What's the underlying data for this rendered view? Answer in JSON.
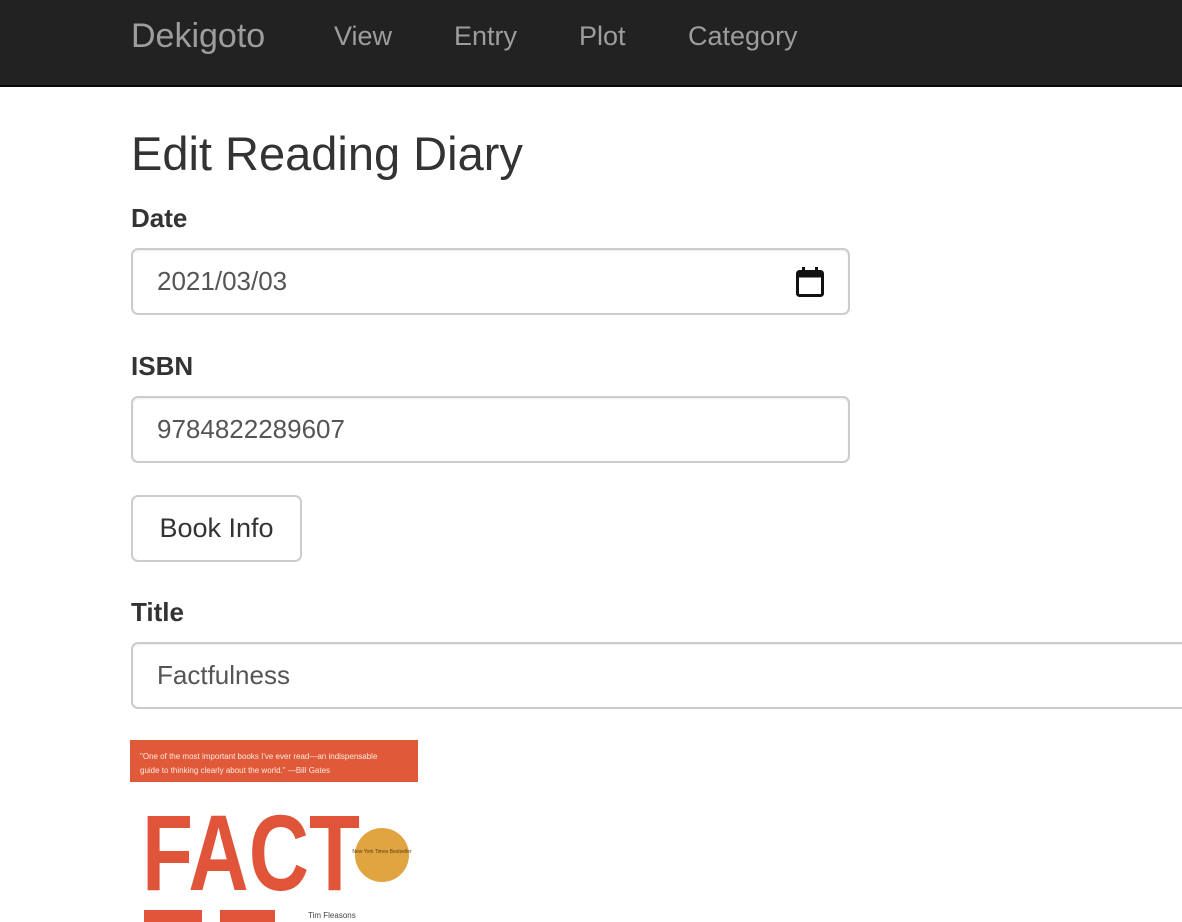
{
  "navbar": {
    "brand": "Dekigoto",
    "items": [
      {
        "label": "View"
      },
      {
        "label": "Entry"
      },
      {
        "label": "Plot"
      },
      {
        "label": "Category"
      }
    ]
  },
  "page_title": "Edit Reading Diary",
  "form": {
    "date": {
      "label": "Date",
      "value": "2021/03/03"
    },
    "isbn": {
      "label": "ISBN",
      "value": "9784822289607"
    },
    "book_info_button": "Book Info",
    "title": {
      "label": "Title",
      "value": "Factfulness"
    }
  },
  "cover": {
    "quote_line1": "\"One of the most important books I've ever read—an indispensable",
    "quote_line2": "guide to thinking clearly about the world.\" —Bill Gates",
    "big_text": "FACT",
    "seal_text": "New York Times Bestseller",
    "author_partial": "Tim Fleasons",
    "colors": {
      "banner": "#e05a3a",
      "text": "#e0553a",
      "seal": "#e0a540"
    }
  }
}
